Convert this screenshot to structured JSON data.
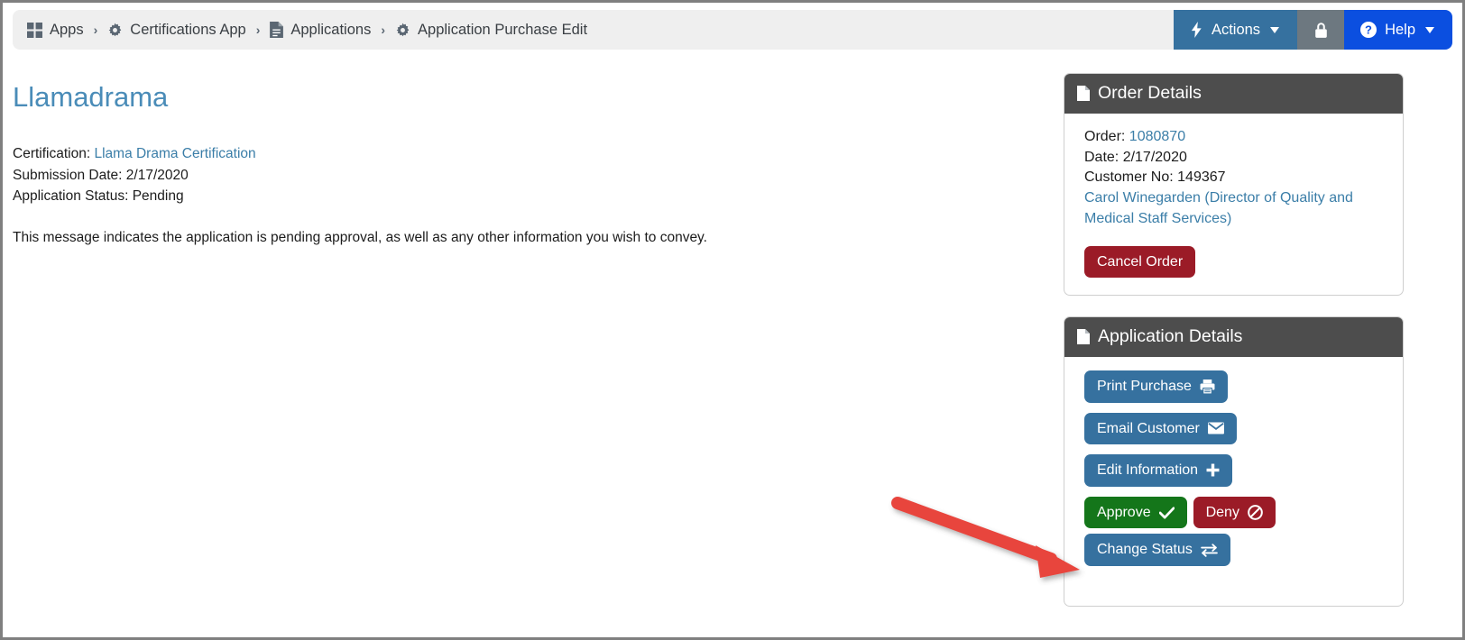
{
  "breadcrumb": {
    "items": [
      {
        "label": "Apps",
        "icon": "grid-icon"
      },
      {
        "label": "Certifications App",
        "icon": "gear-icon"
      },
      {
        "label": "Applications",
        "icon": "document-icon"
      },
      {
        "label": "Application Purchase Edit",
        "icon": "gear-icon"
      }
    ],
    "separator": "›"
  },
  "topbar": {
    "actions_label": "Actions",
    "actions_icon": "lightning-bolt-icon",
    "lock_icon": "lock-icon",
    "help_label": "Help",
    "help_icon": "question-circle-icon"
  },
  "main": {
    "title": "Llamadrama",
    "certification_label": "Certification:",
    "certification_link": "Llama Drama Certification",
    "submission_date": "Submission Date: 2/17/2020",
    "application_status": "Application Status: Pending",
    "message": "This message indicates the application is pending approval, as well as any other information you wish to convey."
  },
  "order_details": {
    "title": "Order Details",
    "icon": "document-icon",
    "order_label": "Order:",
    "order_value": "1080870",
    "date": "Date: 2/17/2020",
    "customer_no": "Customer No: 149367",
    "customer_name": "Carol Winegarden (Director of Quality and Medical Staff Services)",
    "cancel_button": "Cancel Order"
  },
  "application_details": {
    "title": "Application Details",
    "icon": "document-icon",
    "buttons": [
      {
        "label": "Print Purchase",
        "icon": "printer-icon",
        "style": "primary"
      },
      {
        "label": "Email Customer",
        "icon": "envelope-icon",
        "style": "primary"
      },
      {
        "label": "Edit Information",
        "icon": "plus-icon",
        "style": "primary"
      },
      {
        "label": "Approve",
        "icon": "check-icon",
        "style": "success"
      },
      {
        "label": "Deny",
        "icon": "ban-icon",
        "style": "deny"
      },
      {
        "label": "Change Status",
        "icon": "exchange-icon",
        "style": "primary"
      }
    ]
  },
  "annotation": {
    "arrow_color": "#e8453c",
    "points_to": "Change Status"
  },
  "colors": {
    "panel_header": "#4d4d4d",
    "primary_button": "#36719f",
    "danger_button": "#9b1b27",
    "success_button": "#14761a",
    "help_button": "#0b4fe0",
    "lock_button": "#6d7880",
    "link": "#3b7ea8",
    "title": "#4a8cb8",
    "breadcrumb_bg": "#efefef"
  }
}
